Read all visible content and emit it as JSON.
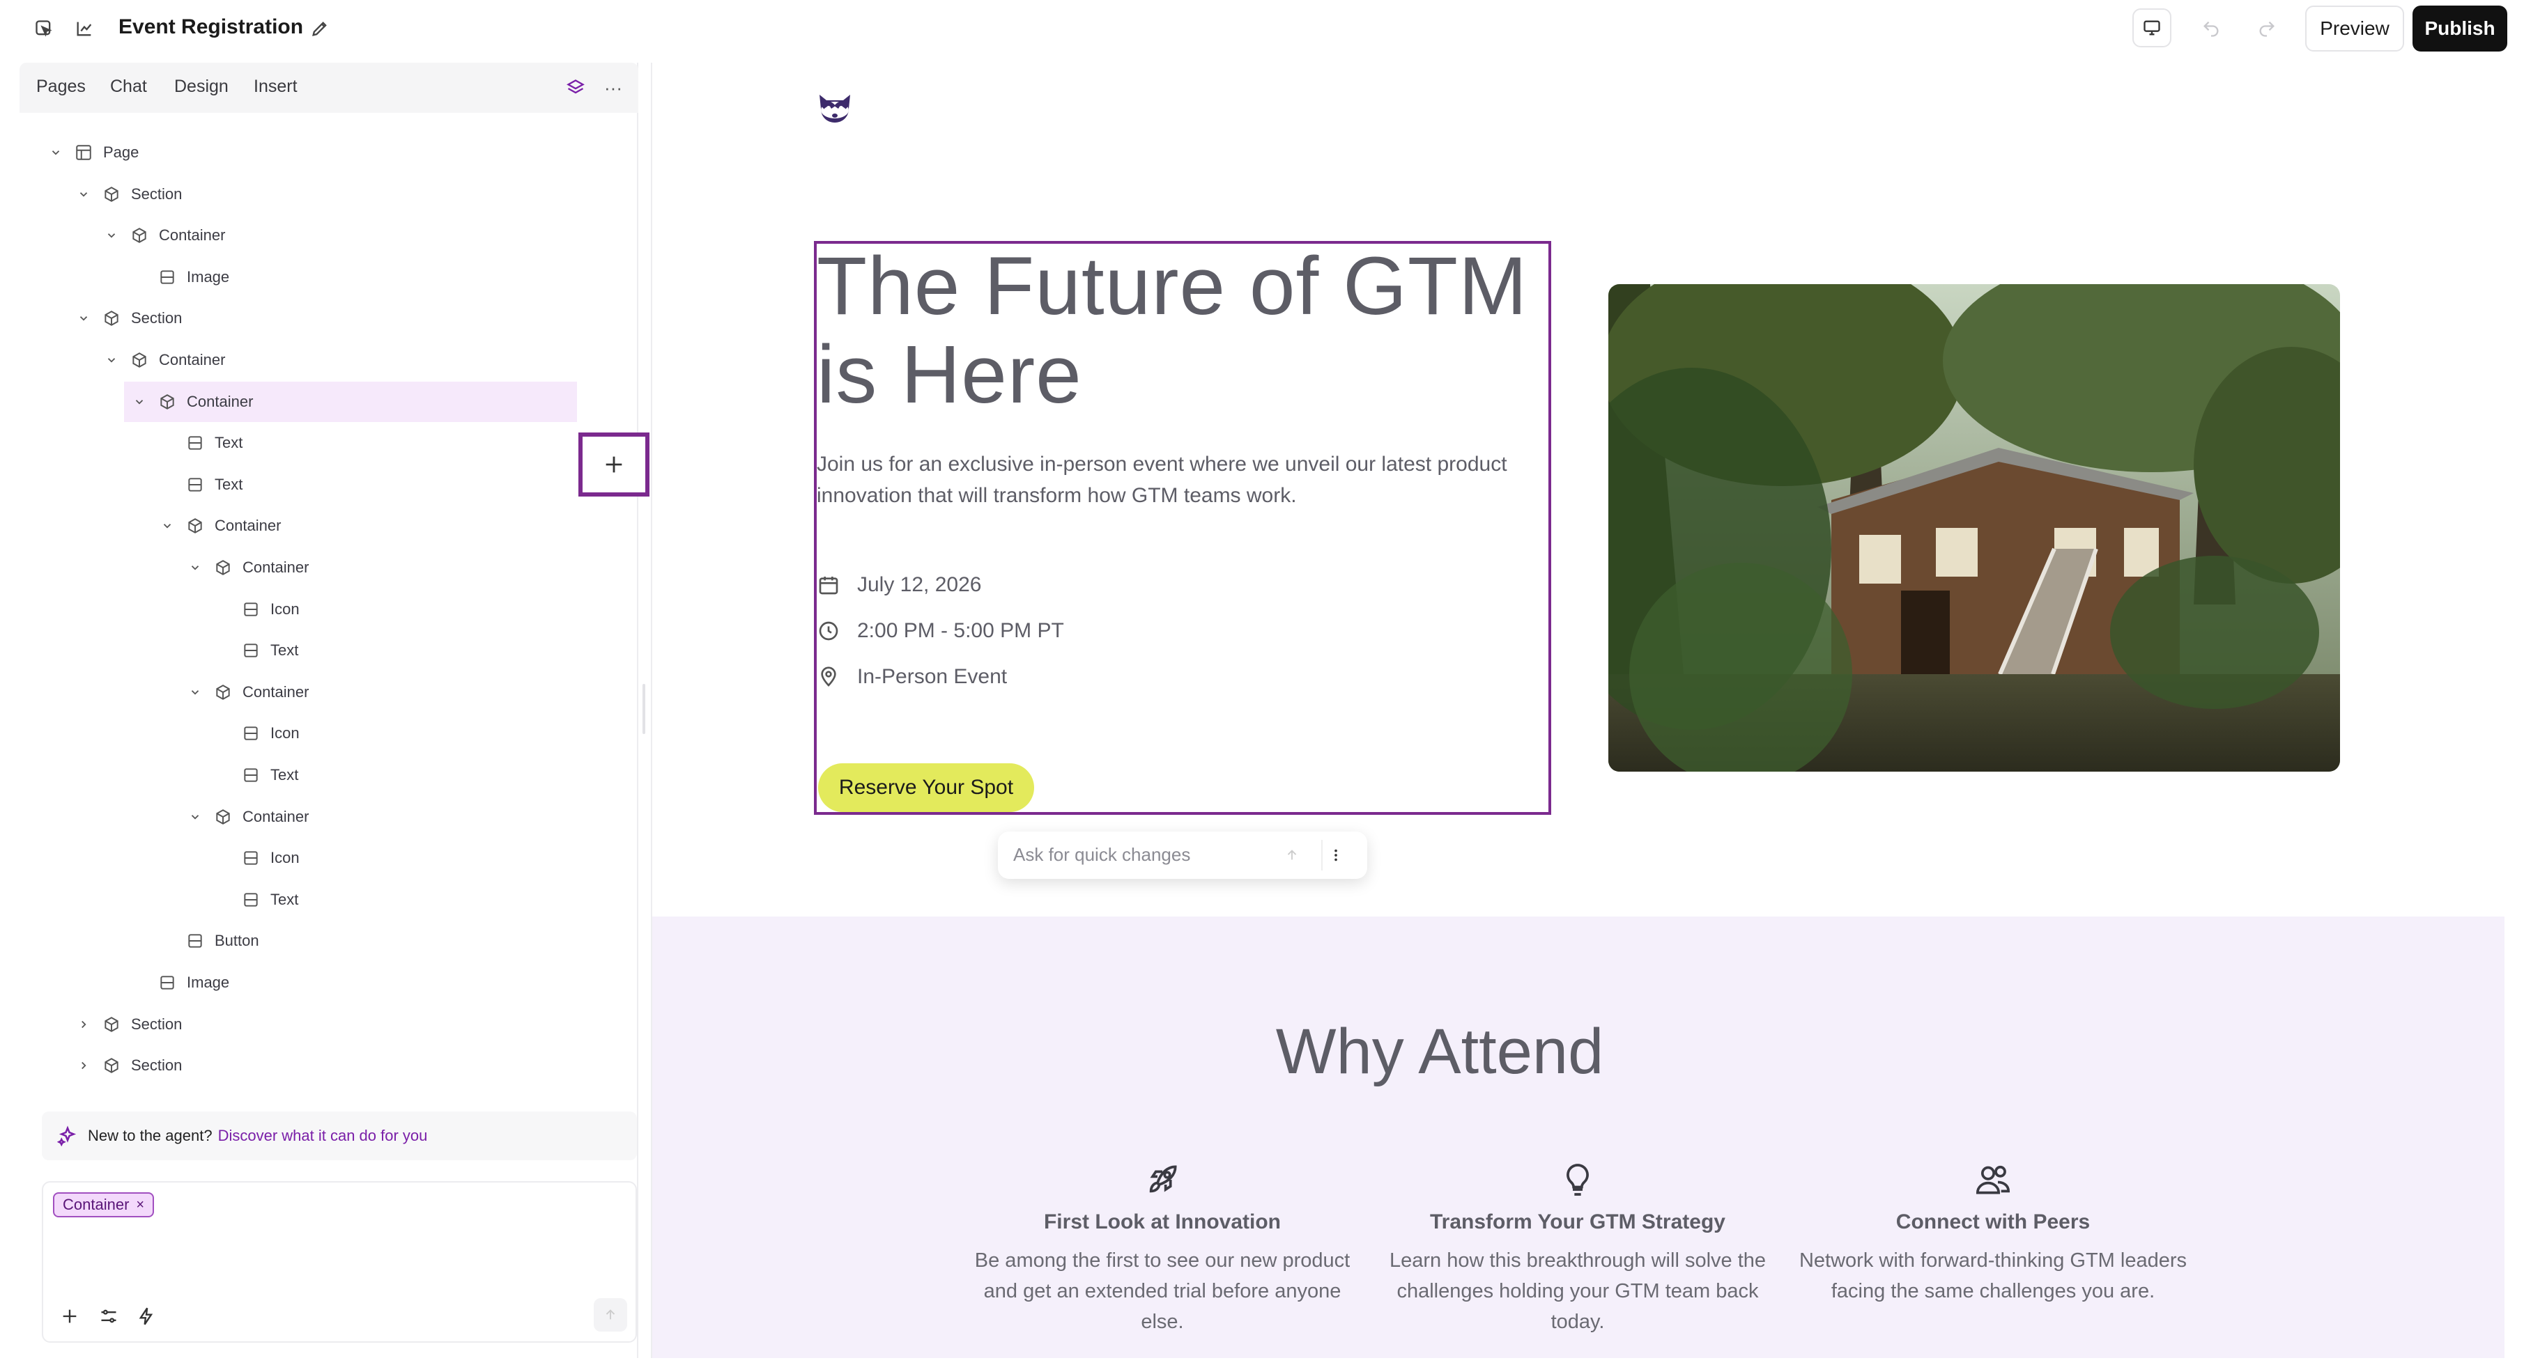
{
  "app": {
    "doc_title": "Event Registration",
    "preview_label": "Preview",
    "publish_label": "Publish"
  },
  "panel": {
    "tabs": [
      "Pages",
      "Chat",
      "Design",
      "Insert"
    ],
    "tree": [
      {
        "label": "Page",
        "type": "page",
        "expanded": true
      },
      {
        "label": "Section",
        "type": "box",
        "expanded": true
      },
      {
        "label": "Container",
        "type": "box",
        "expanded": true
      },
      {
        "label": "Image",
        "type": "leaf"
      },
      {
        "label": "Section",
        "type": "box",
        "expanded": true
      },
      {
        "label": "Container",
        "type": "box",
        "expanded": true
      },
      {
        "label": "Container",
        "type": "box",
        "expanded": true,
        "selected": true
      },
      {
        "label": "Text",
        "type": "leaf"
      },
      {
        "label": "Text",
        "type": "leaf"
      },
      {
        "label": "Container",
        "type": "box",
        "expanded": true
      },
      {
        "label": "Container",
        "type": "box",
        "expanded": true
      },
      {
        "label": "Icon",
        "type": "leaf"
      },
      {
        "label": "Text",
        "type": "leaf"
      },
      {
        "label": "Container",
        "type": "box",
        "expanded": true
      },
      {
        "label": "Icon",
        "type": "leaf"
      },
      {
        "label": "Text",
        "type": "leaf"
      },
      {
        "label": "Container",
        "type": "box",
        "expanded": true
      },
      {
        "label": "Icon",
        "type": "leaf"
      },
      {
        "label": "Text",
        "type": "leaf"
      },
      {
        "label": "Button",
        "type": "leaf"
      },
      {
        "label": "Image",
        "type": "leaf"
      },
      {
        "label": "Section",
        "type": "box",
        "expanded": false
      },
      {
        "label": "Section",
        "type": "box",
        "expanded": false
      }
    ],
    "agent_hint": "New to the agent?",
    "agent_hint_link": "Discover what it can do for you",
    "context_chip": "Container"
  },
  "canvas": {
    "hero": {
      "title": "The Future of GTM is Here",
      "description": "Join us for an exclusive in-person event where we unveil our latest product innovation that will transform how GTM teams work.",
      "details": [
        {
          "icon": "calendar-icon",
          "text": "July 12, 2026"
        },
        {
          "icon": "clock-icon",
          "text": "2:00 PM - 5:00 PM PT"
        },
        {
          "icon": "location-pin-icon",
          "text": "In-Person Event"
        }
      ],
      "cta_label": "Reserve Your Spot"
    },
    "quick_changes_placeholder": "Ask for quick changes",
    "why": {
      "title": "Why Attend",
      "features": [
        {
          "icon": "rocket-icon",
          "title": "First Look at Innovation",
          "description": "Be among the first to see our new product and get an extended trial before anyone else."
        },
        {
          "icon": "lightbulb-icon",
          "title": "Transform Your GTM Strategy",
          "description": "Learn how this breakthrough will solve the challenges holding your GTM team back today."
        },
        {
          "icon": "users-icon",
          "title": "Connect with Peers",
          "description": "Network with forward-thinking GTM leaders facing the same challenges you are."
        }
      ]
    }
  },
  "colors": {
    "accent": "#7b2a8e",
    "cta": "#e3ea5c",
    "section_bg": "#f5f0fb",
    "selected_row": "#f6e9fb"
  }
}
